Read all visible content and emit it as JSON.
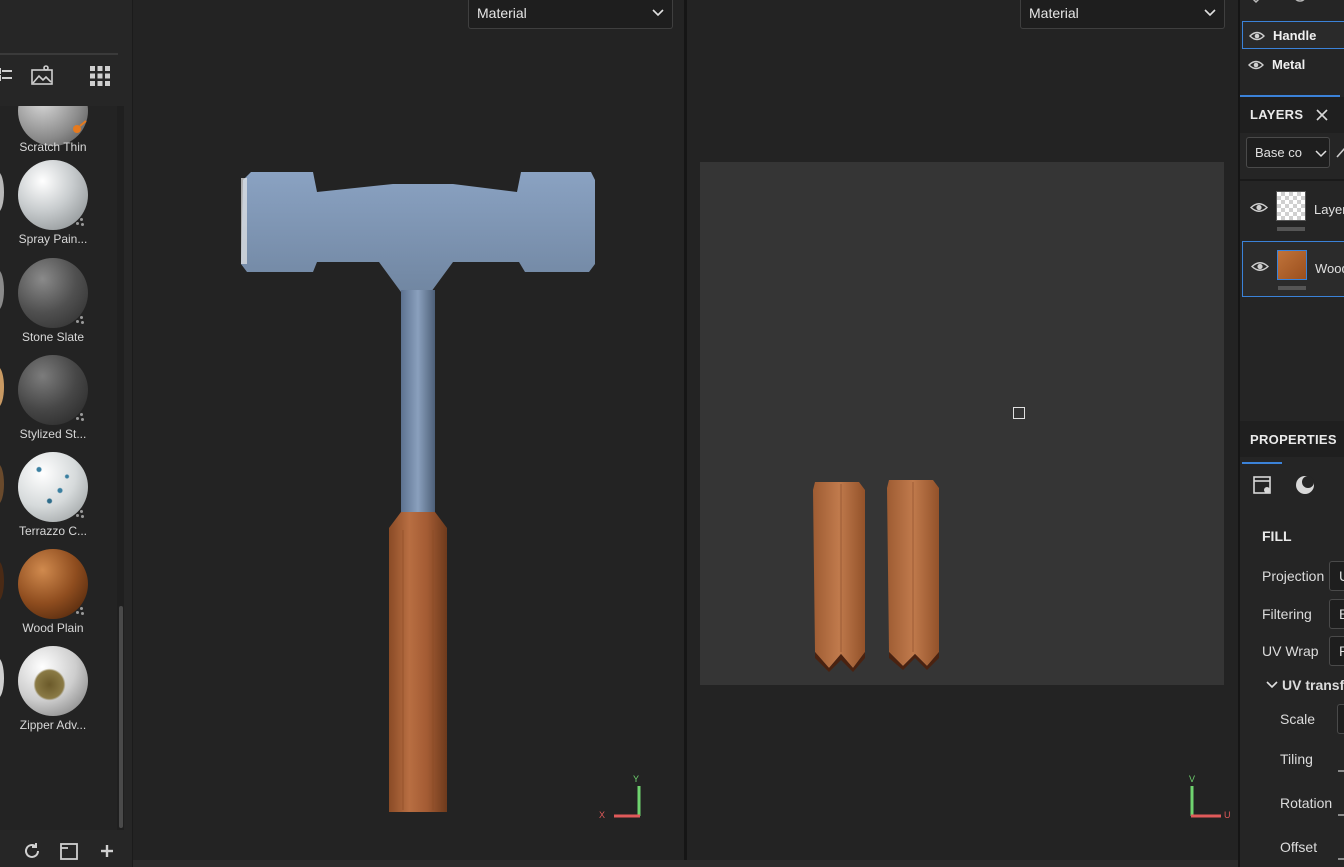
{
  "shelf": {
    "materials": [
      {
        "name": "Scratch Thin"
      },
      {
        "name": "Spray Pain..."
      },
      {
        "name": "Stone Slate"
      },
      {
        "name": "Stylized St..."
      },
      {
        "name": "Terrazzo C..."
      },
      {
        "name": "Wood Plain"
      },
      {
        "name": "Zipper Adv..."
      }
    ]
  },
  "viewport3d": {
    "mode": "Material",
    "axis_x": "X",
    "axis_y": "Y"
  },
  "viewport2d": {
    "mode": "Material",
    "axis_u": "U",
    "axis_v": "V"
  },
  "texture_sets": {
    "items": [
      {
        "name": "Handle",
        "selected": true
      },
      {
        "name": "Metal",
        "selected": false
      }
    ]
  },
  "layers": {
    "title": "LAYERS",
    "channel": "Base co",
    "items": [
      {
        "name": "Layer",
        "selected": false
      },
      {
        "name": "Wood",
        "selected": true
      }
    ]
  },
  "properties": {
    "title": "PROPERTIES",
    "section": "FILL",
    "projection_label": "Projection",
    "projection_value": "U",
    "filtering_label": "Filtering",
    "filtering_value": "B",
    "uvwrap_label": "UV Wrap",
    "uvwrap_value": "R",
    "uv_transform_label": "UV transf",
    "scale_label": "Scale",
    "tiling_label": "Tiling",
    "rotation_label": "Rotation",
    "offset_label": "Offset"
  },
  "colors": {
    "accent": "#3b82d8",
    "axis_x": "#e05a5a",
    "axis_y": "#6fd36f"
  }
}
